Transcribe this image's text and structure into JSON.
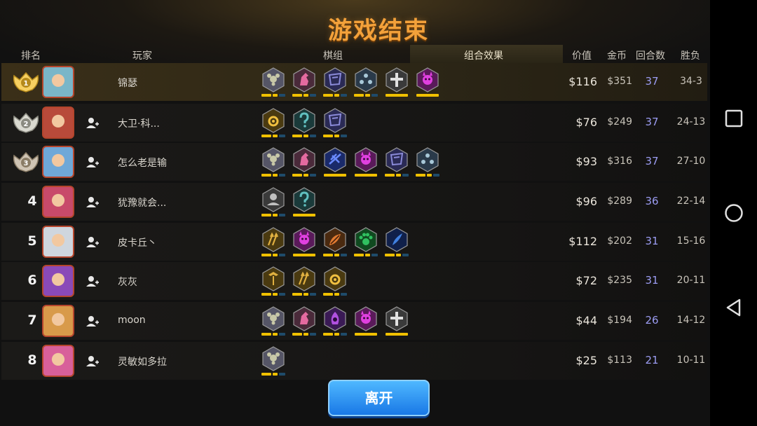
{
  "title": "游戏结束",
  "headers": {
    "rank": "排名",
    "player": "玩家",
    "pieces": "棋组",
    "combo": "组合效果",
    "value": "价值",
    "gold": "金币",
    "rounds": "回合数",
    "winloss": "胜负"
  },
  "leave_label": "离开",
  "colors": {
    "title": "#f3a13a",
    "rounds_text": "#9b9cf2",
    "pip_active": "#f0c000",
    "pip_inactive": "#1f4b6a",
    "leave_button": "#2b90f0"
  },
  "players": [
    {
      "rank": "1",
      "medal": "gold",
      "name": "锦瑟",
      "value": "$116",
      "gold": "$351",
      "rounds": "37",
      "record": "34-3",
      "traits": [
        {
          "icon": "goblin-icon",
          "color": "#c8c8a8",
          "frame": "#556",
          "pips": "mixed"
        },
        {
          "icon": "knight-icon",
          "color": "#e46aa0",
          "frame": "#4a2a3a",
          "pips": "mixed"
        },
        {
          "icon": "demon-hunter-icon",
          "color": "#8a8ad8",
          "frame": "#2a2a55",
          "pips": "mixed"
        },
        {
          "icon": "troll-icon",
          "color": "#a8c8d8",
          "frame": "#2a3a4a",
          "pips": "mixed"
        },
        {
          "icon": "warrior-cross-icon",
          "color": "#e0e0e0",
          "frame": "#3a3a3a",
          "pips": "full"
        },
        {
          "icon": "demon-icon",
          "color": "#e040e0",
          "frame": "#5a1a5a",
          "pips": "full"
        }
      ]
    },
    {
      "rank": "2",
      "medal": "silver",
      "name": "大卫·科...",
      "value": "$76",
      "gold": "$249",
      "rounds": "37",
      "record": "24-13",
      "traits": [
        {
          "icon": "beast-icon",
          "color": "#f0c040",
          "frame": "#4a3a10",
          "pips": "mixed"
        },
        {
          "icon": "mage-icon",
          "color": "#60c0c0",
          "frame": "#1a3a3a",
          "pips": "mixed"
        },
        {
          "icon": "demon-hunter-icon",
          "color": "#8a8ad8",
          "frame": "#2a2a55",
          "pips": "mixed"
        }
      ]
    },
    {
      "rank": "3",
      "medal": "bronze",
      "name": "怎么老是输",
      "value": "$93",
      "gold": "$316",
      "rounds": "37",
      "record": "27-10",
      "traits": [
        {
          "icon": "goblin-icon",
          "color": "#c8c8a8",
          "frame": "#556",
          "pips": "mixed"
        },
        {
          "icon": "knight-icon",
          "color": "#e46aa0",
          "frame": "#4a2a3a",
          "pips": "mixed"
        },
        {
          "icon": "dragon-icon",
          "color": "#6a8aff",
          "frame": "#1a2a6a",
          "pips": "full"
        },
        {
          "icon": "demon-icon",
          "color": "#e040e0",
          "frame": "#5a1a5a",
          "pips": "full"
        },
        {
          "icon": "demon-hunter-icon",
          "color": "#8a8ad8",
          "frame": "#2a2a55",
          "pips": "mixed"
        },
        {
          "icon": "troll-icon",
          "color": "#a8c8d8",
          "frame": "#2a3a4a",
          "pips": "mixed"
        }
      ]
    },
    {
      "rank": "4",
      "medal": "",
      "name": "犹豫就会...",
      "value": "$96",
      "gold": "$289",
      "rounds": "36",
      "record": "22-14",
      "traits": [
        {
          "icon": "human-icon",
          "color": "#c0c0c0",
          "frame": "#3a3a3a",
          "pips": "mixed"
        },
        {
          "icon": "mage-icon",
          "color": "#60c0c0",
          "frame": "#1a3a3a",
          "pips": "full"
        }
      ]
    },
    {
      "rank": "5",
      "medal": "",
      "name": "皮卡丘丶",
      "value": "$112",
      "gold": "$202",
      "rounds": "31",
      "record": "15-16",
      "traits": [
        {
          "icon": "hunter-icon",
          "color": "#e0b040",
          "frame": "#4a3a10",
          "pips": "mixed"
        },
        {
          "icon": "demon-icon",
          "color": "#e040e0",
          "frame": "#5a1a5a",
          "pips": "full"
        },
        {
          "icon": "elf-icon",
          "color": "#e07a30",
          "frame": "#4a2a10",
          "pips": "mixed"
        },
        {
          "icon": "beast-paw-icon",
          "color": "#30c060",
          "frame": "#104a20",
          "pips": "mixed"
        },
        {
          "icon": "naga-icon",
          "color": "#4080e0",
          "frame": "#10204a",
          "pips": "mixed"
        }
      ]
    },
    {
      "rank": "6",
      "medal": "",
      "name": "灰灰",
      "value": "$72",
      "gold": "$235",
      "rounds": "31",
      "record": "20-11",
      "traits": [
        {
          "icon": "dwarf-icon",
          "color": "#e0b040",
          "frame": "#4a3a10",
          "pips": "mixed"
        },
        {
          "icon": "hunter-icon",
          "color": "#e0b040",
          "frame": "#4a3a10",
          "pips": "mixed"
        },
        {
          "icon": "beast-icon",
          "color": "#f0c040",
          "frame": "#4a3a10",
          "pips": "mixed"
        }
      ]
    },
    {
      "rank": "7",
      "medal": "",
      "name": "moon",
      "value": "$44",
      "gold": "$194",
      "rounds": "26",
      "record": "14-12",
      "traits": [
        {
          "icon": "goblin-icon",
          "color": "#c8c8a8",
          "frame": "#556",
          "pips": "mixed"
        },
        {
          "icon": "knight-icon",
          "color": "#e46aa0",
          "frame": "#4a2a3a",
          "pips": "mixed"
        },
        {
          "icon": "warlock-icon",
          "color": "#b050e0",
          "frame": "#3a1a55",
          "pips": "mixed"
        },
        {
          "icon": "demon-icon",
          "color": "#e040e0",
          "frame": "#5a1a5a",
          "pips": "full"
        },
        {
          "icon": "warrior-cross-icon",
          "color": "#e0e0e0",
          "frame": "#3a3a3a",
          "pips": "full"
        }
      ]
    },
    {
      "rank": "8",
      "medal": "",
      "name": "灵敏如多拉",
      "value": "$25",
      "gold": "$113",
      "rounds": "21",
      "record": "10-11",
      "traits": [
        {
          "icon": "goblin-icon",
          "color": "#c8c8a8",
          "frame": "#556",
          "pips": "mixed"
        }
      ]
    }
  ]
}
